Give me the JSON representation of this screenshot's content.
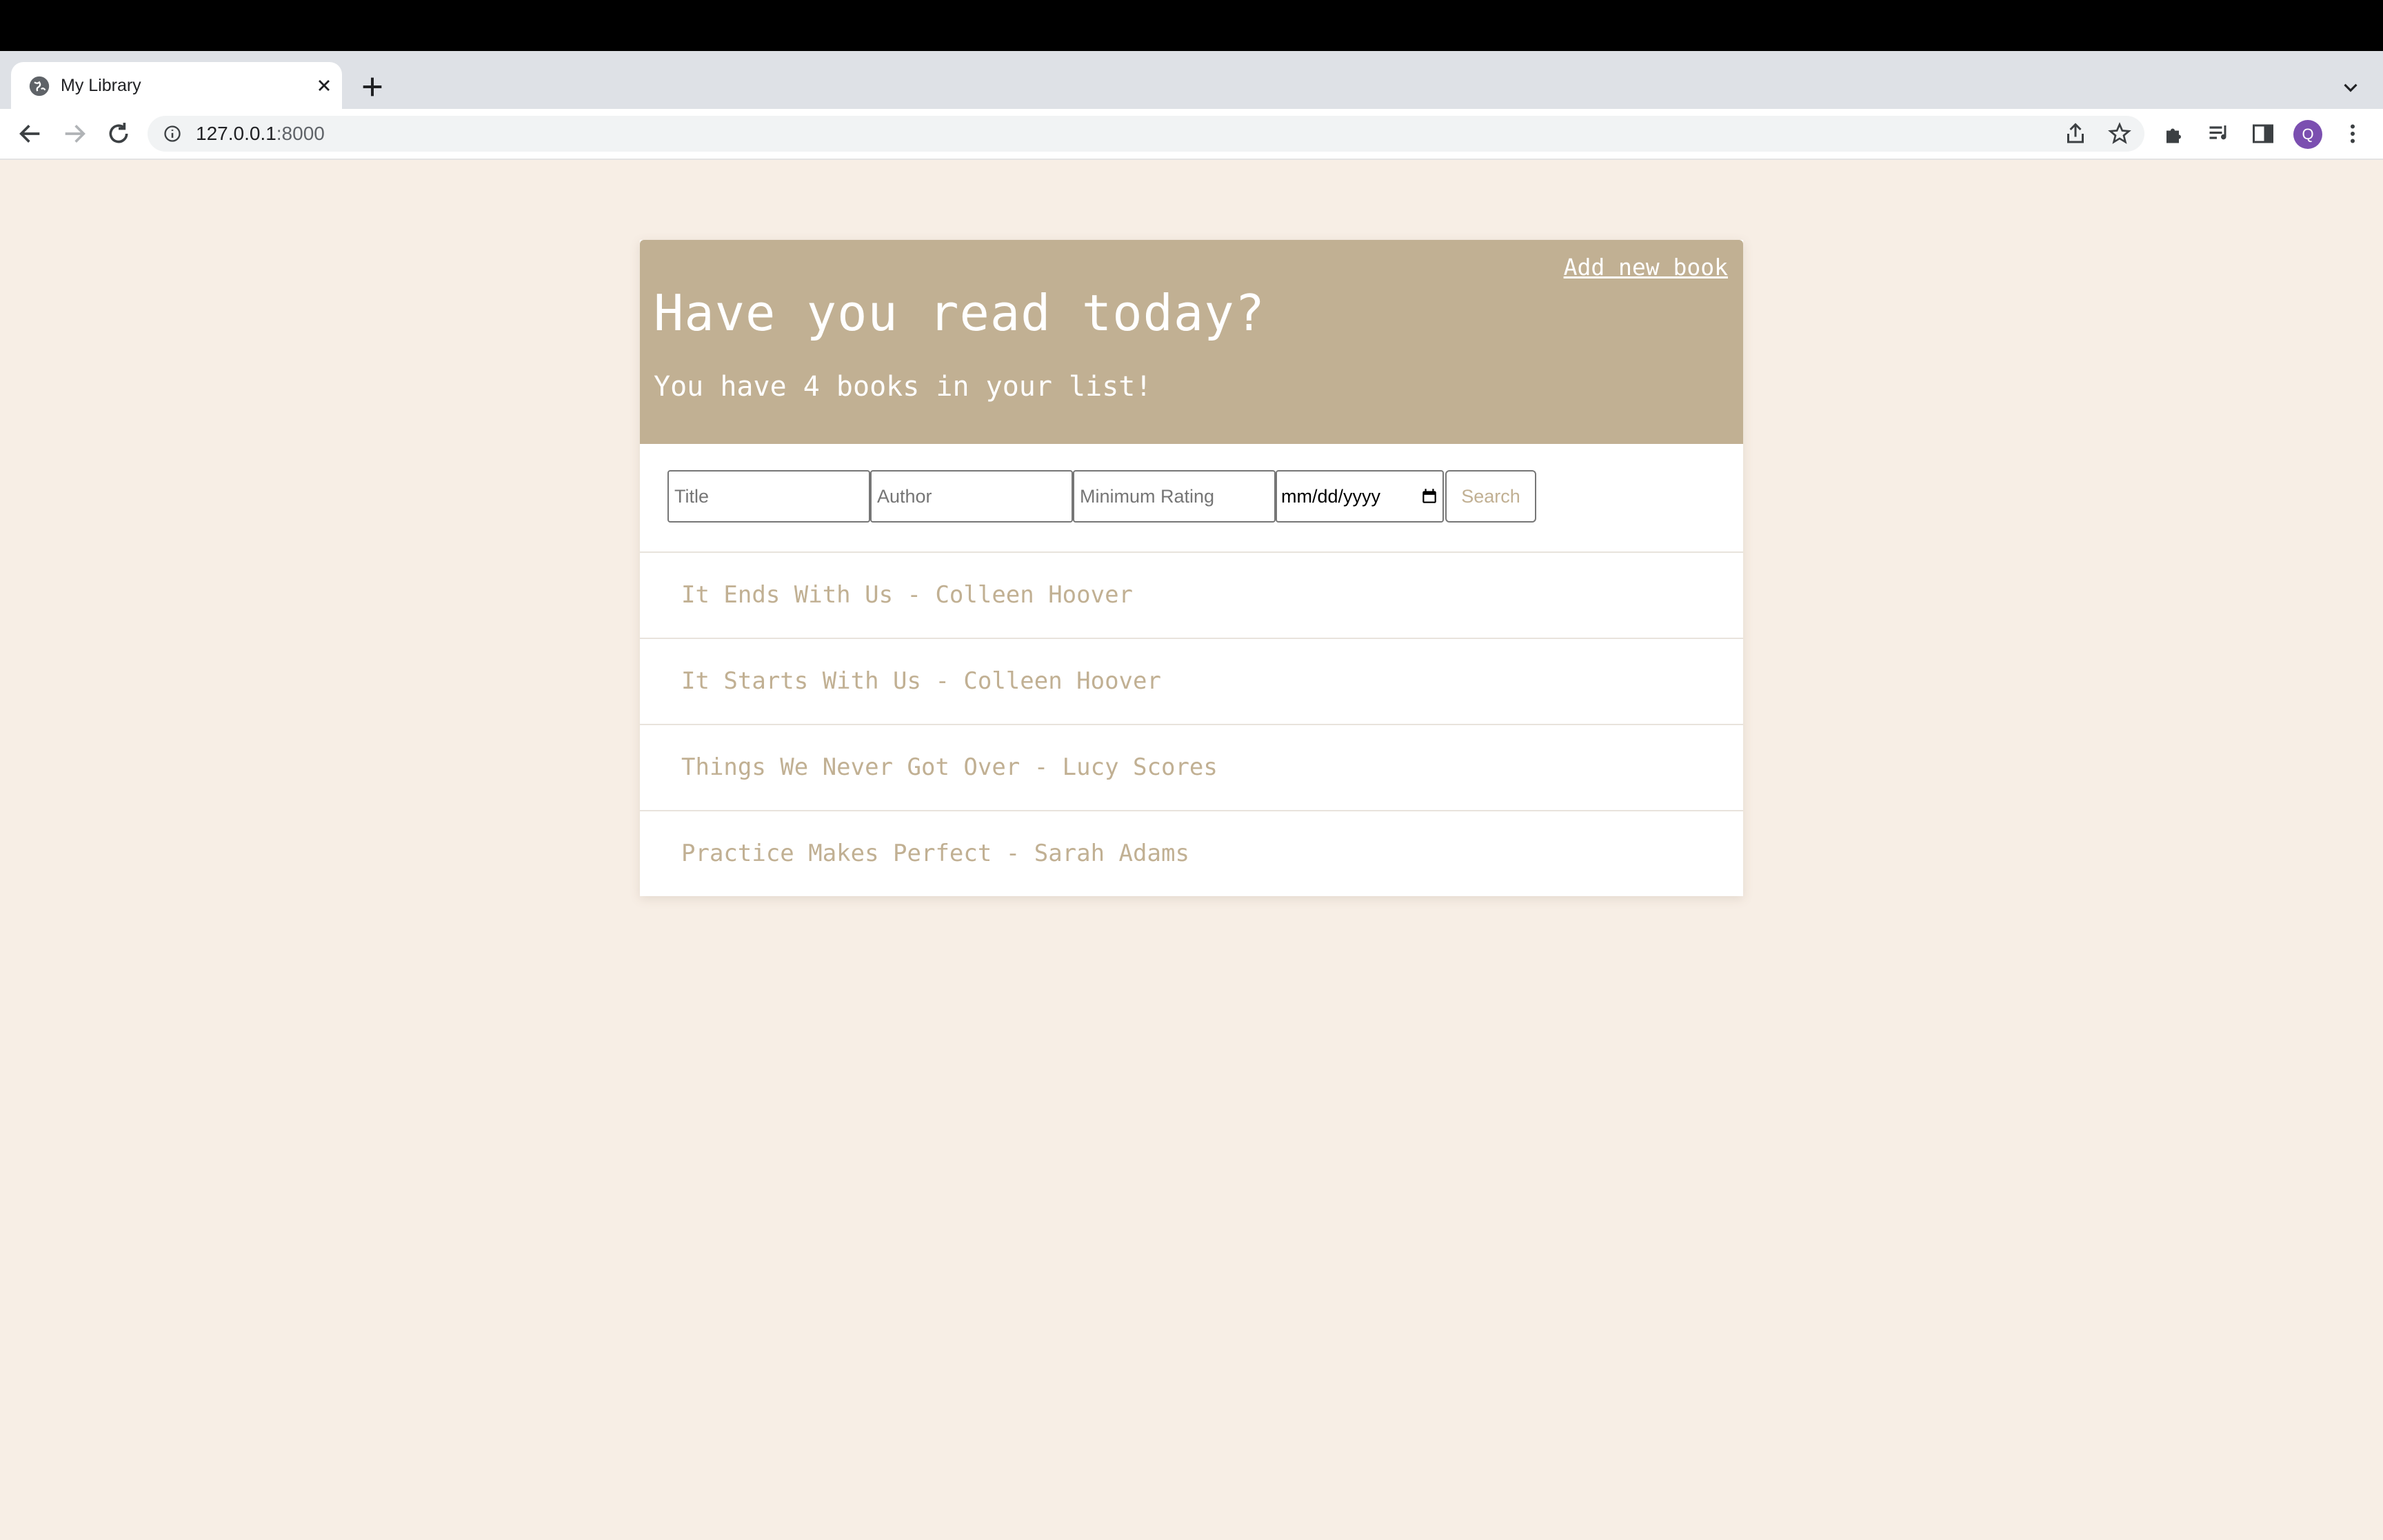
{
  "browser": {
    "tab": {
      "title": "My Library"
    },
    "address": {
      "host": "127.0.0.1",
      "port": ":8000"
    },
    "profile_initial": "Q"
  },
  "header": {
    "add_link": "Add new book",
    "heading": "Have you read today?",
    "subheading": "You have 4 books in your list!"
  },
  "search": {
    "title_placeholder": "Title",
    "author_placeholder": "Author",
    "rating_placeholder": "Minimum Rating",
    "date_placeholder": "mm/dd/yyyy",
    "button_label": "Search"
  },
  "books": [
    {
      "label": "It Ends With Us - Colleen Hoover"
    },
    {
      "label": "It Starts With Us - Colleen Hoover"
    },
    {
      "label": "Things We Never Got Over - Lucy Scores"
    },
    {
      "label": "Practice Makes Perfect - Sarah Adams"
    }
  ],
  "colors": {
    "page_bg": "#f7eee5",
    "accent": "#c1b093",
    "card_bg": "#ffffff"
  }
}
